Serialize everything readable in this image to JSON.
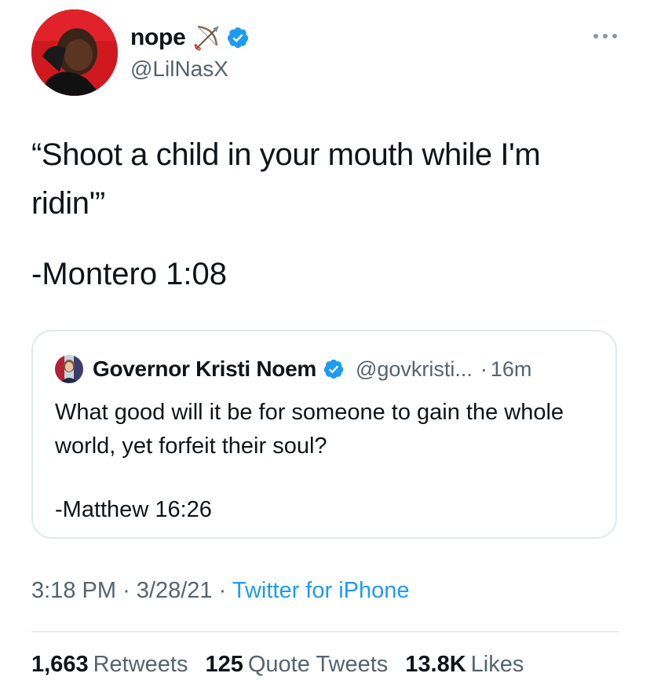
{
  "tweet": {
    "author": {
      "display_name": "nope",
      "handle": "@LilNasX",
      "emoji": "bow-and-arrow-icon",
      "verified": true
    },
    "text": "“Shoot a child in your mouth while I'm ridin'”",
    "signature": "-Montero 1:08",
    "quoted": {
      "display_name": "Governor Kristi Noem",
      "handle": "@govkristi...",
      "separator": "·",
      "time": "16m",
      "verified": true,
      "text": "What good will it be for someone to gain the whole world, yet forfeit their soul?",
      "signature": "-Matthew 16:26"
    },
    "meta": {
      "time": "3:18 PM",
      "sep1": "·",
      "date": "3/28/21",
      "sep2": "·",
      "source": "Twitter for iPhone"
    },
    "stats": {
      "retweets_count": "1,663",
      "retweets_label": "Retweets",
      "quotes_count": "125",
      "quotes_label": "Quote Tweets",
      "likes_count": "13.8K",
      "likes_label": "Likes"
    }
  },
  "colors": {
    "text": "#0f1419",
    "secondary": "#536471",
    "link": "#1d9bf0",
    "verified": "#1d9bf0",
    "border": "#e1e8ed"
  }
}
